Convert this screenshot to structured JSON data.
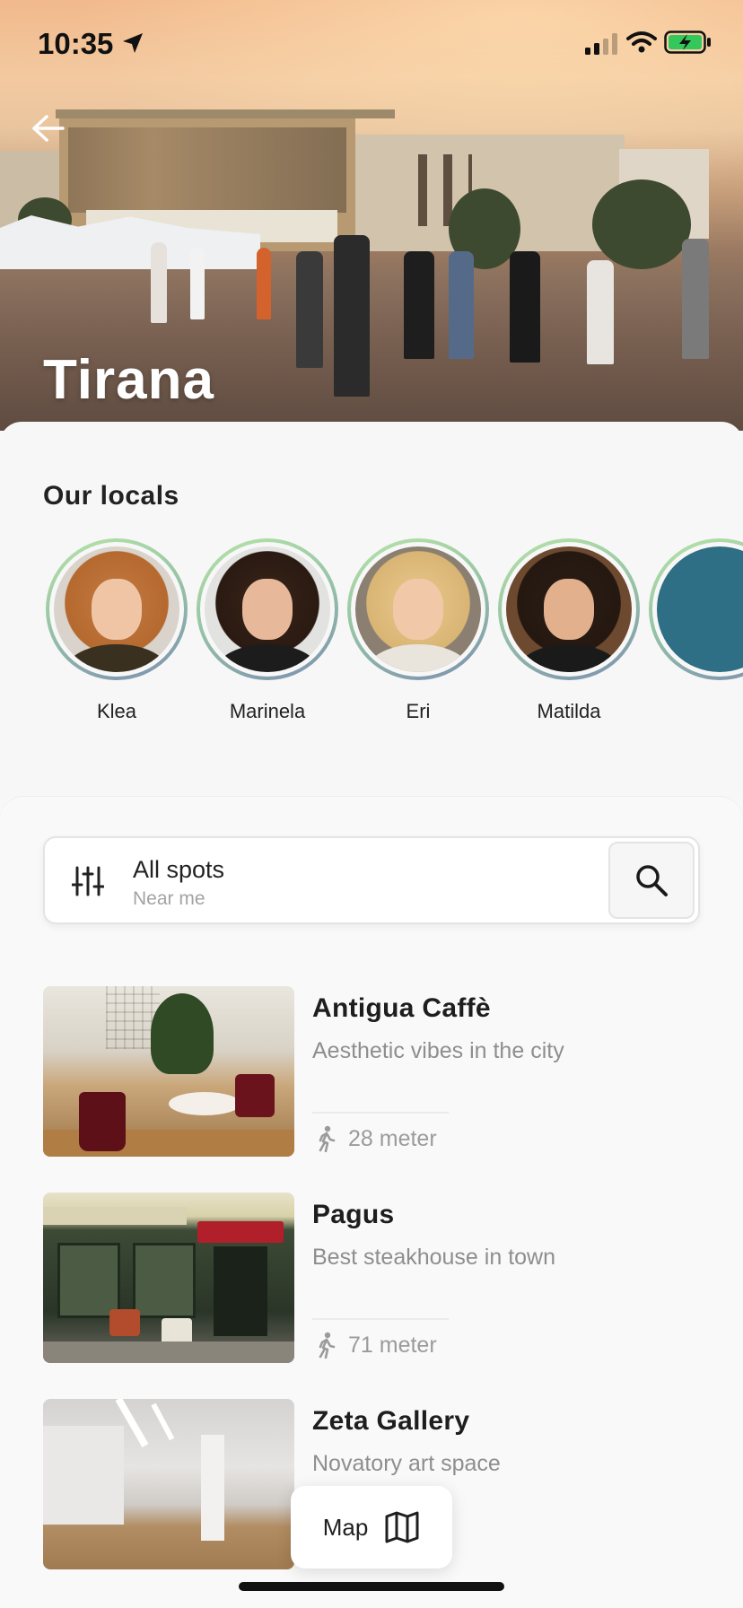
{
  "status_bar": {
    "time": "10:35"
  },
  "hero": {
    "city": "Tirana"
  },
  "locals": {
    "title": "Our locals",
    "people": [
      {
        "name": "Klea"
      },
      {
        "name": "Marinela"
      },
      {
        "name": "Eri"
      },
      {
        "name": "Matilda"
      }
    ]
  },
  "filter": {
    "title": "All spots",
    "subtitle": "Near me"
  },
  "spots": [
    {
      "name": "Antigua Caffè",
      "description": "Aesthetic vibes in the city",
      "distance": "28 meter"
    },
    {
      "name": "Pagus",
      "description": "Best steakhouse in town",
      "distance": "71 meter"
    },
    {
      "name": "Zeta Gallery",
      "description": "Novatory art space",
      "distance": ""
    }
  ],
  "map_button": {
    "label": "Map"
  },
  "icons": {
    "back": "back-arrow-icon",
    "filter": "sliders-icon",
    "search": "search-icon",
    "walk": "walking-person-icon",
    "map": "map-icon"
  },
  "colors": {
    "ring_start": "#b7e3a7",
    "ring_end": "#7c8fb0",
    "battery": "#34c759"
  }
}
